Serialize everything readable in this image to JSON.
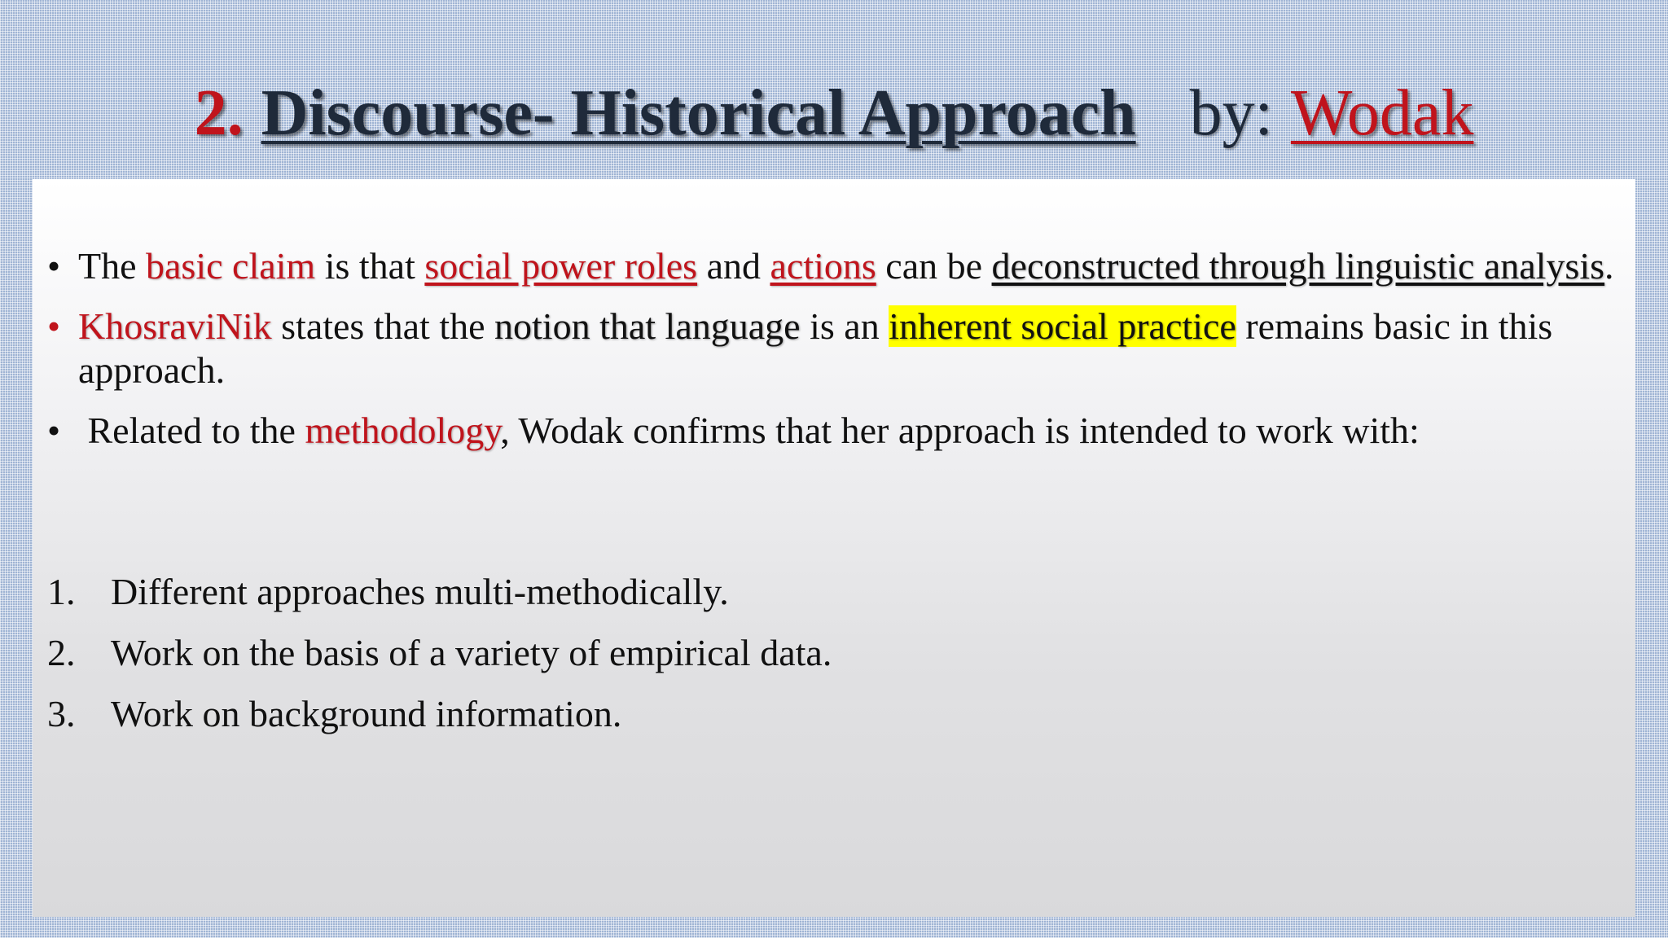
{
  "title": {
    "number": "2.",
    "main": "Discourse- Historical Approach",
    "by": "by:",
    "author": "Wodak"
  },
  "bullets": [
    {
      "marker": "•",
      "parts": [
        "The ",
        "basic claim",
        " is that ",
        "social power roles",
        " and ",
        "actions",
        " can be ",
        "deconstructed through linguistic analysis",
        "."
      ]
    },
    {
      "marker": "•",
      "parts": [
        "KhosraviNik",
        " states that the ",
        "notion that language",
        " is an ",
        "inherent social practice",
        " remains basic in this approach."
      ]
    },
    {
      "marker": "•",
      "parts": [
        " Related to the ",
        "methodology",
        ", Wodak confirms that her approach is intended to work with:"
      ]
    }
  ],
  "numbered_list": [
    {
      "marker": "1.",
      "text": "Different approaches multi-methodically."
    },
    {
      "marker": "2.",
      "text": "Work on the basis of a variety of empirical data."
    },
    {
      "marker": "3.",
      "text": "Work on background information."
    }
  ],
  "colors": {
    "accent_red": "#c0141c",
    "title_dark": "#1f2a3a",
    "highlight_yellow": "#ffff00",
    "background_blue": "#9fb4d4"
  }
}
